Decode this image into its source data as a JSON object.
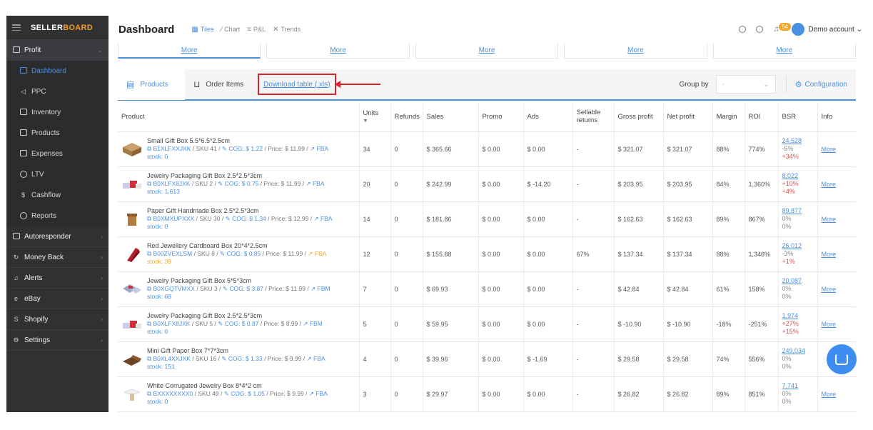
{
  "app": {
    "logo_part1": "SELLER",
    "logo_part2": "BOARD"
  },
  "sidebar": {
    "items": [
      {
        "label": "Profit",
        "chevron": "⌄"
      },
      {
        "label": "Dashboard"
      },
      {
        "label": "PPC"
      },
      {
        "label": "Inventory"
      },
      {
        "label": "Products"
      },
      {
        "label": "Expenses"
      },
      {
        "label": "LTV"
      },
      {
        "label": "Cashflow"
      },
      {
        "label": "Reports"
      },
      {
        "label": "Autoresponder",
        "chevron": "›"
      },
      {
        "label": "Money Back",
        "chevron": "›"
      },
      {
        "label": "Alerts",
        "chevron": "›"
      },
      {
        "label": "eBay",
        "chevron": "›"
      },
      {
        "label": "Shopify",
        "chevron": "›"
      },
      {
        "label": "Settings",
        "chevron": "›"
      }
    ]
  },
  "header": {
    "title": "Dashboard",
    "views": [
      "Tiles",
      "Chart",
      "P&L",
      "Trends"
    ],
    "notifications": "54",
    "account": "Demo account"
  },
  "more_row": [
    "More",
    "More",
    "More",
    "More",
    "More"
  ],
  "toolbar": {
    "tabs": [
      "Products",
      "Order Items"
    ],
    "download_link": "Download table (.xls)",
    "group_by_label": "Group by",
    "group_by_value": "-",
    "configuration": "Configuration"
  },
  "table": {
    "headers": [
      "Product",
      "Units",
      "Refunds",
      "Sales",
      "Promo",
      "Ads",
      "Sellable returns",
      "Gross profit",
      "Net profit",
      "Margin",
      "ROI",
      "BSR",
      "Info"
    ],
    "rows": [
      {
        "name": "Small Gift Box 5.5*6.5*2.5cm",
        "asin": "B1XLFXXJXK",
        "sku": "SKU 41",
        "cog": "COG: $ 1.22",
        "price": "Price: $ 11.99",
        "fulfil": "FBA",
        "stock": "stock: 0",
        "units": "34",
        "refunds": "0",
        "sales": "$ 365.66",
        "promo": "$ 0.00",
        "ads": "$ 0.00",
        "returns": "-",
        "gross": "$ 321.07",
        "net": "$ 321.07",
        "margin": "88%",
        "roi": "774%",
        "bsr": "24,528",
        "bsr1": "-5%",
        "bsr2": "+34%",
        "info": "More"
      },
      {
        "name": "Jewelry Packaging Gift Box 2.5*2.5*3cm",
        "asin": "B0XLFX8JXK",
        "sku": "SKU 2",
        "cog": "COG: $ 0.75",
        "price": "Price: $ 11.99",
        "fulfil": "FBA",
        "stock": "stock: 1,613",
        "units": "20",
        "refunds": "0",
        "sales": "$ 242.99",
        "promo": "$ 0.00",
        "ads": "$ -14.20",
        "returns": "-",
        "gross": "$ 203.95",
        "net": "$ 203.95",
        "margin": "84%",
        "roi": "1,360%",
        "bsr": "8,022",
        "bsr1": "+10%",
        "bsr2": "+4%",
        "info": "More"
      },
      {
        "name": "Paper Gift Handmade Box 2.5*2.5*3cm",
        "asin": "B0XMXUPXXX",
        "sku": "SKU 30",
        "cog": "COG: $ 1.34",
        "price": "Price: $ 12.99",
        "fulfil": "FBA",
        "stock": "stock: 0",
        "units": "14",
        "refunds": "0",
        "sales": "$ 181.86",
        "promo": "$ 0.00",
        "ads": "$ 0.00",
        "returns": "-",
        "gross": "$ 162.63",
        "net": "$ 162.63",
        "margin": "89%",
        "roi": "867%",
        "bsr": "89,877",
        "bsr1": "0%",
        "bsr2": "0%",
        "info": "More"
      },
      {
        "name": "Red Jewellery Cardboard Box 20*4*2.5cm",
        "asin": "B00ZVEXLSM",
        "sku": "SKU 8",
        "cog": "COG: $ 0.85",
        "price": "Price: $ 11.99",
        "fulfil": "FBA",
        "stock": "stock: 39",
        "units": "12",
        "refunds": "0",
        "sales": "$ 155.88",
        "promo": "$ 0.00",
        "ads": "$ 0.00",
        "returns": "67%",
        "gross": "$ 137.34",
        "net": "$ 137.34",
        "margin": "88%",
        "roi": "1,346%",
        "bsr": "26,012",
        "bsr1": "-3%",
        "bsr2": "+1%",
        "info": "More"
      },
      {
        "name": "Jewelry Packaging Gift Box 5*5*3cm",
        "asin": "B0XGQTVMXX",
        "sku": "SKU 3",
        "cog": "COG: $ 3.87",
        "price": "Price: $ 11.99",
        "fulfil": "FBM",
        "stock": "stock: 68",
        "units": "7",
        "refunds": "0",
        "sales": "$ 69.93",
        "promo": "$ 0.00",
        "ads": "$ 0.00",
        "returns": "-",
        "gross": "$ 42.84",
        "net": "$ 42.84",
        "margin": "61%",
        "roi": "158%",
        "bsr": "20,087",
        "bsr1": "0%",
        "bsr2": "0%",
        "info": "More"
      },
      {
        "name": "Jewelry Packaging Gift Box 2.5*2.5*3cm",
        "asin": "B0XLFX8JXK",
        "sku": "SKU 5",
        "cog": "COG: $ 0.87",
        "price": "Price: $ 8.99",
        "fulfil": "FBM",
        "stock": "stock: 0",
        "units": "5",
        "refunds": "0",
        "sales": "$ 59.95",
        "promo": "$ 0.00",
        "ads": "$ 0.00",
        "returns": "-",
        "gross": "$ -10.90",
        "net": "$ -10.90",
        "margin": "-18%",
        "roi": "-251%",
        "bsr": "1,974",
        "bsr1": "+27%",
        "bsr2": "+15%",
        "info": "More"
      },
      {
        "name": "Mini Gift Paper Box 7*7*3cm",
        "asin": "B0XL4XXJXK",
        "sku": "SKU 16",
        "cog": "COG: $ 1.33",
        "price": "Price: $ 9.99",
        "fulfil": "FBA",
        "stock": "stock: 151",
        "units": "4",
        "refunds": "0",
        "sales": "$ 39.96",
        "promo": "$ 0.00",
        "ads": "$ -1.69",
        "returns": "-",
        "gross": "$ 29.58",
        "net": "$ 29.58",
        "margin": "74%",
        "roi": "556%",
        "bsr": "249,034",
        "bsr1": "0%",
        "bsr2": "0%",
        "info": ""
      },
      {
        "name": "White Corrugated Jewelry Box 8*4*2 cm",
        "asin": "BXXXXXXXX0",
        "sku": "SKU 49",
        "cog": "COG: $ 1.05",
        "price": "Price: $ 9.99",
        "fulfil": "FBA",
        "stock": "stock: 0",
        "units": "3",
        "refunds": "0",
        "sales": "$ 29.97",
        "promo": "$ 0.00",
        "ads": "$ 0.00",
        "returns": "-",
        "gross": "$ 26.82",
        "net": "$ 26.82",
        "margin": "89%",
        "roi": "851%",
        "bsr": "7,741",
        "bsr1": "0%",
        "bsr2": "0%",
        "info": "More"
      }
    ]
  },
  "colors": {
    "accent": "#4a90e2",
    "sidebar_bg": "#2f3133",
    "highlight": "#d9232a",
    "warn": "#f5a623"
  }
}
